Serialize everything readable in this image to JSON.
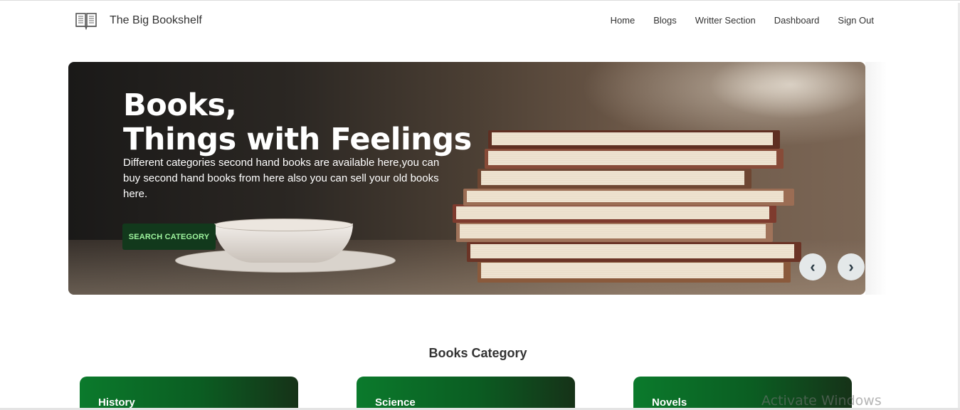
{
  "brand": {
    "name": "The Big Bookshelf",
    "icon": "open-book-icon"
  },
  "nav": {
    "items": [
      {
        "label": "Home"
      },
      {
        "label": "Blogs"
      },
      {
        "label": "Writter Section"
      },
      {
        "label": "Dashboard"
      },
      {
        "label": "Sign Out"
      }
    ]
  },
  "hero": {
    "title_line1": "Books,",
    "title_line2": "Things with Feelings",
    "description": "Different categories second hand books are available here,you can buy second hand books from here also you can sell your old books here.",
    "button_label": "SEARCH CATEGORY",
    "prev_label": "‹",
    "next_label": "›"
  },
  "categories": {
    "title": "Books Category",
    "items": [
      {
        "label": "History"
      },
      {
        "label": "Science"
      },
      {
        "label": "Novels"
      }
    ]
  },
  "os": {
    "watermark": "Activate Windows"
  },
  "colors": {
    "accent_green": "#0b7a2c",
    "button_bg": "#12391c",
    "button_text": "#9ff59f"
  }
}
